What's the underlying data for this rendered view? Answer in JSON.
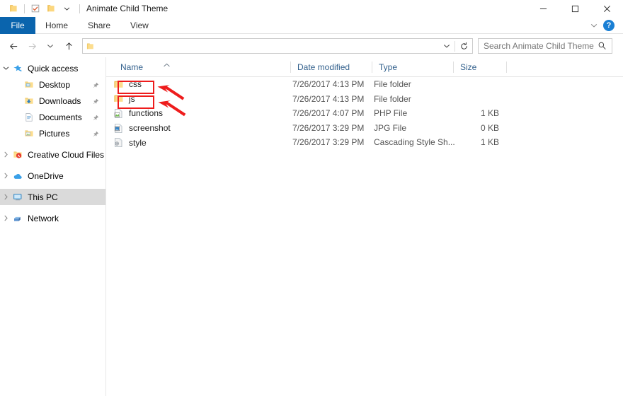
{
  "window": {
    "title": "Animate Child Theme",
    "quick_access_toolbar": [
      {
        "icon": "folder-icon",
        "name": "explorer-icon"
      },
      {
        "icon": "properties-icon",
        "name": "properties-icon"
      },
      {
        "icon": "new-folder-icon",
        "name": "new-folder-icon"
      },
      {
        "icon": "chevron-down-icon",
        "name": "customize-qat-icon"
      }
    ],
    "controls": {
      "minimize": "minimize-icon",
      "maximize": "maximize-icon",
      "close": "close-icon"
    }
  },
  "ribbon": {
    "tabs": [
      {
        "label": "File",
        "active": true
      },
      {
        "label": "Home",
        "active": false
      },
      {
        "label": "Share",
        "active": false
      },
      {
        "label": "View",
        "active": false
      }
    ],
    "collapse_icon": "chevron-down-icon",
    "help_label": "?"
  },
  "navigation": {
    "back_icon": "arrow-left-icon",
    "forward_icon": "arrow-right-icon",
    "recent_icon": "chevron-down-icon",
    "up_icon": "arrow-up-icon",
    "address": {
      "value": "",
      "folder_icon": "folder-icon",
      "dropdown_icon": "chevron-down-icon",
      "refresh_icon": "refresh-icon"
    },
    "search": {
      "placeholder": "Search Animate Child Theme",
      "icon": "search-icon"
    }
  },
  "sidebar": {
    "items": [
      {
        "label": "Quick access",
        "icon": "star-icon",
        "expander": "chevron-down-icon",
        "pinned": false,
        "indent": 0,
        "selected": false
      },
      {
        "label": "Desktop",
        "icon": "desktop-folder-icon",
        "expander": "",
        "pinned": true,
        "indent": 1,
        "selected": false
      },
      {
        "label": "Downloads",
        "icon": "downloads-folder-icon",
        "expander": "",
        "pinned": true,
        "indent": 1,
        "selected": false
      },
      {
        "label": "Documents",
        "icon": "documents-folder-icon",
        "expander": "",
        "pinned": true,
        "indent": 1,
        "selected": false
      },
      {
        "label": "Pictures",
        "icon": "pictures-folder-icon",
        "expander": "",
        "pinned": true,
        "indent": 1,
        "selected": false
      },
      {
        "label": "Creative Cloud Files",
        "icon": "creative-cloud-icon",
        "expander": "chevron-right-icon",
        "pinned": false,
        "indent": 0,
        "selected": false
      },
      {
        "label": "OneDrive",
        "icon": "onedrive-icon",
        "expander": "chevron-right-icon",
        "pinned": false,
        "indent": 0,
        "selected": false
      },
      {
        "label": "This PC",
        "icon": "this-pc-icon",
        "expander": "chevron-right-icon",
        "pinned": false,
        "indent": 0,
        "selected": true
      },
      {
        "label": "Network",
        "icon": "network-icon",
        "expander": "chevron-right-icon",
        "pinned": false,
        "indent": 0,
        "selected": false
      }
    ]
  },
  "file_list": {
    "columns": [
      {
        "label": "Name",
        "sorted": "asc",
        "sort_icon": "caret-up-icon"
      },
      {
        "label": "Date modified",
        "sorted": ""
      },
      {
        "label": "Type",
        "sorted": ""
      },
      {
        "label": "Size",
        "sorted": ""
      }
    ],
    "rows": [
      {
        "name": "css",
        "icon": "folder-icon",
        "date": "7/26/2017 4:13 PM",
        "type": "File folder",
        "size": ""
      },
      {
        "name": "js",
        "icon": "folder-icon",
        "date": "7/26/2017 4:13 PM",
        "type": "File folder",
        "size": ""
      },
      {
        "name": "functions",
        "icon": "php-file-icon",
        "date": "7/26/2017 4:07 PM",
        "type": "PHP File",
        "size": "1 KB"
      },
      {
        "name": "screenshot",
        "icon": "jpg-file-icon",
        "date": "7/26/2017 3:29 PM",
        "type": "JPG File",
        "size": "0 KB"
      },
      {
        "name": "style",
        "icon": "css-file-icon",
        "date": "7/26/2017 3:29 PM",
        "type": "Cascading Style Sh...",
        "size": "1 KB"
      }
    ]
  },
  "annotations": {
    "highlight_color": "#ee1c1c",
    "boxes": [
      {
        "target": "css",
        "name": "annotation-box-css"
      },
      {
        "target": "js",
        "name": "annotation-box-js"
      }
    ],
    "arrows": [
      {
        "target": "css",
        "name": "annotation-arrow-css"
      },
      {
        "target": "js",
        "name": "annotation-arrow-js"
      }
    ]
  }
}
